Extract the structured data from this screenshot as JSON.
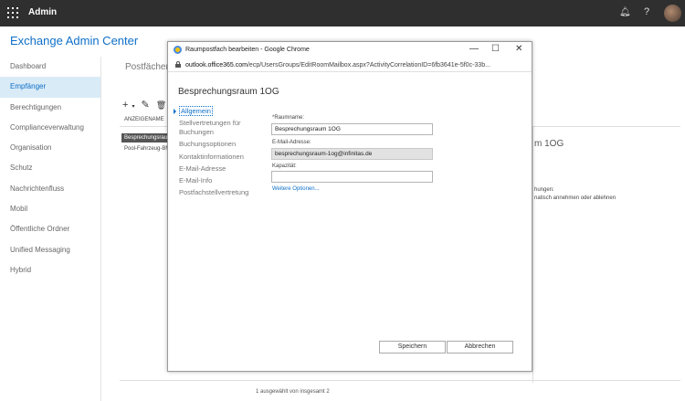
{
  "topbar": {
    "app_name": "Admin",
    "bell_icon": "bell-icon",
    "help_label": "?"
  },
  "eac_title": "Exchange Admin Center",
  "nav": {
    "items": [
      {
        "label": "Dashboard"
      },
      {
        "label": "Empfänger",
        "active": true
      },
      {
        "label": "Berechtigungen"
      },
      {
        "label": "Complianceverwaltung"
      },
      {
        "label": "Organisation"
      },
      {
        "label": "Schutz"
      },
      {
        "label": "Nachrichtenfluss"
      },
      {
        "label": "Mobil"
      },
      {
        "label": "Öffentliche Ordner"
      },
      {
        "label": "Unified Messaging"
      },
      {
        "label": "Hybrid"
      }
    ]
  },
  "background": {
    "section_title": "Postfächer",
    "toolbar": {
      "add": "+",
      "add_caret": "▾",
      "edit": "✎",
      "delete": "🗑"
    },
    "column_header": "ANZEIGENAME",
    "rows": [
      "Besprechungsraum 1OG",
      "Pool-Fahrzeug-BMW"
    ],
    "detail_title": "m 1OG",
    "detail_line1": "hungen:",
    "detail_line2": "natisch annehmen oder ablehnen",
    "status": "1 ausgewählt von insgesamt 2"
  },
  "window": {
    "title": "Raumpostfach bearbeiten - Google Chrome",
    "minimize": "—",
    "maximize": "☐",
    "close": "✕",
    "url_domain": "outlook.office365.com",
    "url_path": "/ecp/UsersGroups/EditRoomMailbox.aspx?ActivityCorrelationID=6fb3641e-5f0c-33b..."
  },
  "dialog": {
    "heading": "Besprechungsraum 1OG",
    "sidebar": [
      {
        "label": "Allgemein",
        "active": true
      },
      {
        "label": "Stellvertretungen für Buchungen"
      },
      {
        "label": "Buchungsoptionen"
      },
      {
        "label": "Kontaktinformationen"
      },
      {
        "label": "E-Mail-Adresse"
      },
      {
        "label": "E-Mail-Info"
      },
      {
        "label": "Postfachstellvertretung"
      }
    ],
    "fields": {
      "room_name_label": "*Raumname:",
      "room_name_value": "Besprechungsraum 1OG",
      "email_label": "E-Mail-Adresse:",
      "email_value": "besprechungsraum-1og@infinitas.de",
      "capacity_label": "Kapazität:",
      "capacity_value": ""
    },
    "more_options": "Weitere Optionen...",
    "save_label": "Speichern",
    "cancel_label": "Abbrechen"
  },
  "colors": {
    "accent": "#0e6fc8",
    "topbar": "#2f2f2f",
    "nav_active_bg": "#d9ebf7"
  }
}
